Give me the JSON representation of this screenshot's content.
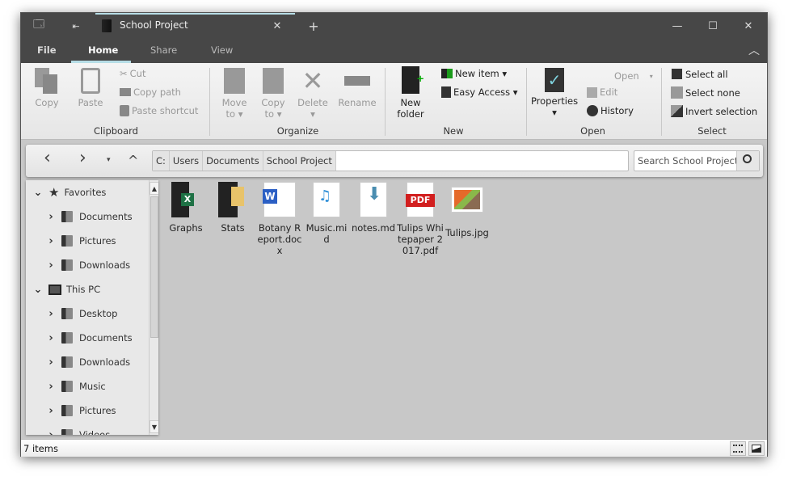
{
  "titlebar": {
    "tab_title": "School Project",
    "new_tab": "+",
    "close_tab": "✕",
    "minimize": "—",
    "maximize": "☐",
    "close": "✕"
  },
  "ribbon_tabs": [
    "File",
    "Home",
    "Share",
    "View"
  ],
  "ribbon": {
    "clipboard": {
      "label": "Clipboard",
      "copy": "Copy",
      "paste": "Paste",
      "cut": "Cut",
      "copy_path": "Copy path",
      "paste_shortcut": "Paste shortcut"
    },
    "organize": {
      "label": "Organize",
      "move_to": "Move",
      "move_to2": "to ▾",
      "copy_to": "Copy",
      "copy_to2": "to ▾",
      "delete": "Delete",
      "delete2": "▾",
      "rename": "Rename"
    },
    "new": {
      "label": "New",
      "new_folder": "New",
      "new_folder2": "folder",
      "new_item": "New item ▾",
      "easy_access": "Easy Access ▾"
    },
    "open": {
      "label": "Open",
      "properties": "Properties",
      "properties2": "▾",
      "open": "Open",
      "edit": "Edit",
      "history": "History"
    },
    "select": {
      "label": "Select",
      "select_all": "Select all",
      "select_none": "Select none",
      "invert": "Invert selection"
    }
  },
  "nav": {
    "back": "‹",
    "forward": "›",
    "recent": "▾",
    "up": "^",
    "breadcrumb": [
      "C:",
      "Users",
      "Documents",
      "School Project"
    ],
    "search_placeholder": "Search School Project"
  },
  "tree": {
    "favorites": "Favorites",
    "fav_items": [
      "Documents",
      "Pictures",
      "Downloads"
    ],
    "this_pc": "This PC",
    "pc_items": [
      "Desktop",
      "Documents",
      "Downloads",
      "Music",
      "Pictures",
      "Videos"
    ]
  },
  "files": [
    {
      "name": "Graphs",
      "type": "folder-excel"
    },
    {
      "name": "Stats",
      "type": "folder"
    },
    {
      "name": "Botany Report.docx",
      "type": "word"
    },
    {
      "name": "Music.mid",
      "type": "audio"
    },
    {
      "name": "notes.md",
      "type": "markdown"
    },
    {
      "name": "Tulips Whitepaper 2017.pdf",
      "type": "pdf"
    },
    {
      "name": "Tulips.jpg",
      "type": "image"
    }
  ],
  "status": {
    "items": "7 items"
  }
}
